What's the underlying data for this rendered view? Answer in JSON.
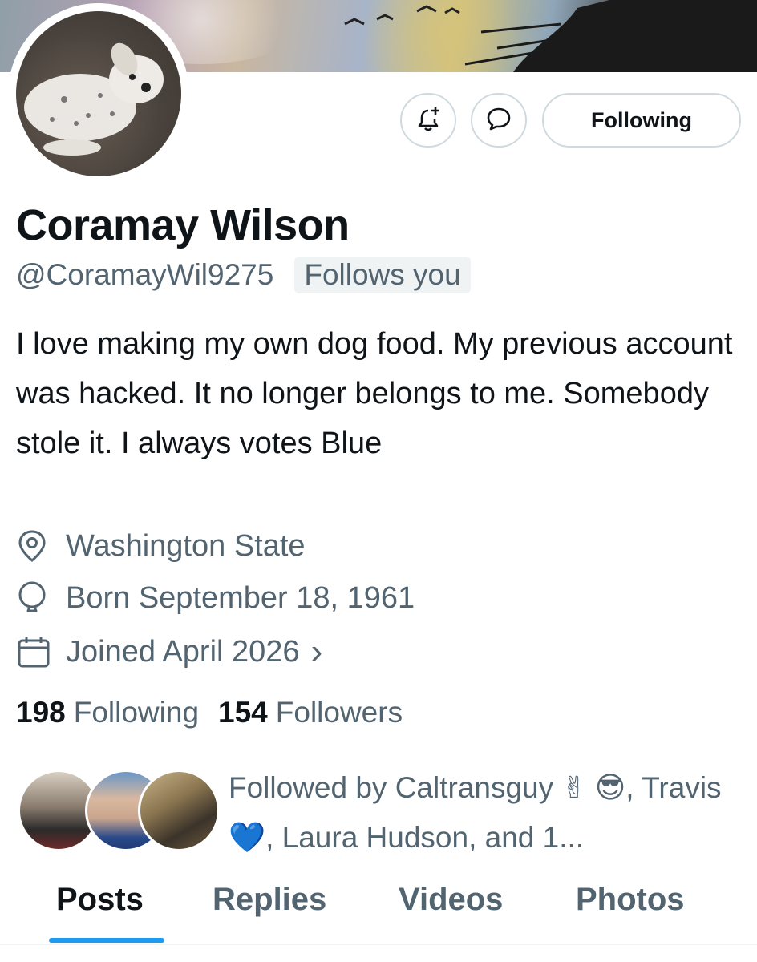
{
  "profile": {
    "name": "Coramay Wilson",
    "handle": "@CoramayWil9275",
    "follows_you": "Follows you",
    "bio": "I love making my own dog food. My previous account was hacked. It no longer belongs to me. Somebody stole it. I always votes Blue",
    "location": "Washington State",
    "born": "Born September 18, 1961",
    "joined": "Joined April 2026",
    "joined_chevron": "›"
  },
  "actions": {
    "following_label": "Following"
  },
  "stats": {
    "following_count": "198",
    "following_label": "Following",
    "followers_count": "154",
    "followers_label": "Followers"
  },
  "followed_by": {
    "prefix": "Followed by Caltransguy ",
    "emoji1": "✌",
    "emoji2": "😎",
    "mid": ", Travis ",
    "emoji3": "💙",
    "suffix": ", Laura Hudson, and 1..."
  },
  "tabs": [
    {
      "label": "Posts",
      "active": true
    },
    {
      "label": "Replies",
      "active": false
    },
    {
      "label": "Videos",
      "active": false
    },
    {
      "label": "Photos",
      "active": false
    }
  ],
  "colors": {
    "accent": "#1d9bf0",
    "secondary_text": "#536471",
    "primary_text": "#0f1419",
    "border": "#cfd9de",
    "badge_bg": "#eff3f4"
  },
  "icons": {
    "notify": "bell-plus-icon",
    "message": "message-bubble-icon",
    "location": "location-pin-icon",
    "born": "balloon-icon",
    "joined": "calendar-icon"
  }
}
